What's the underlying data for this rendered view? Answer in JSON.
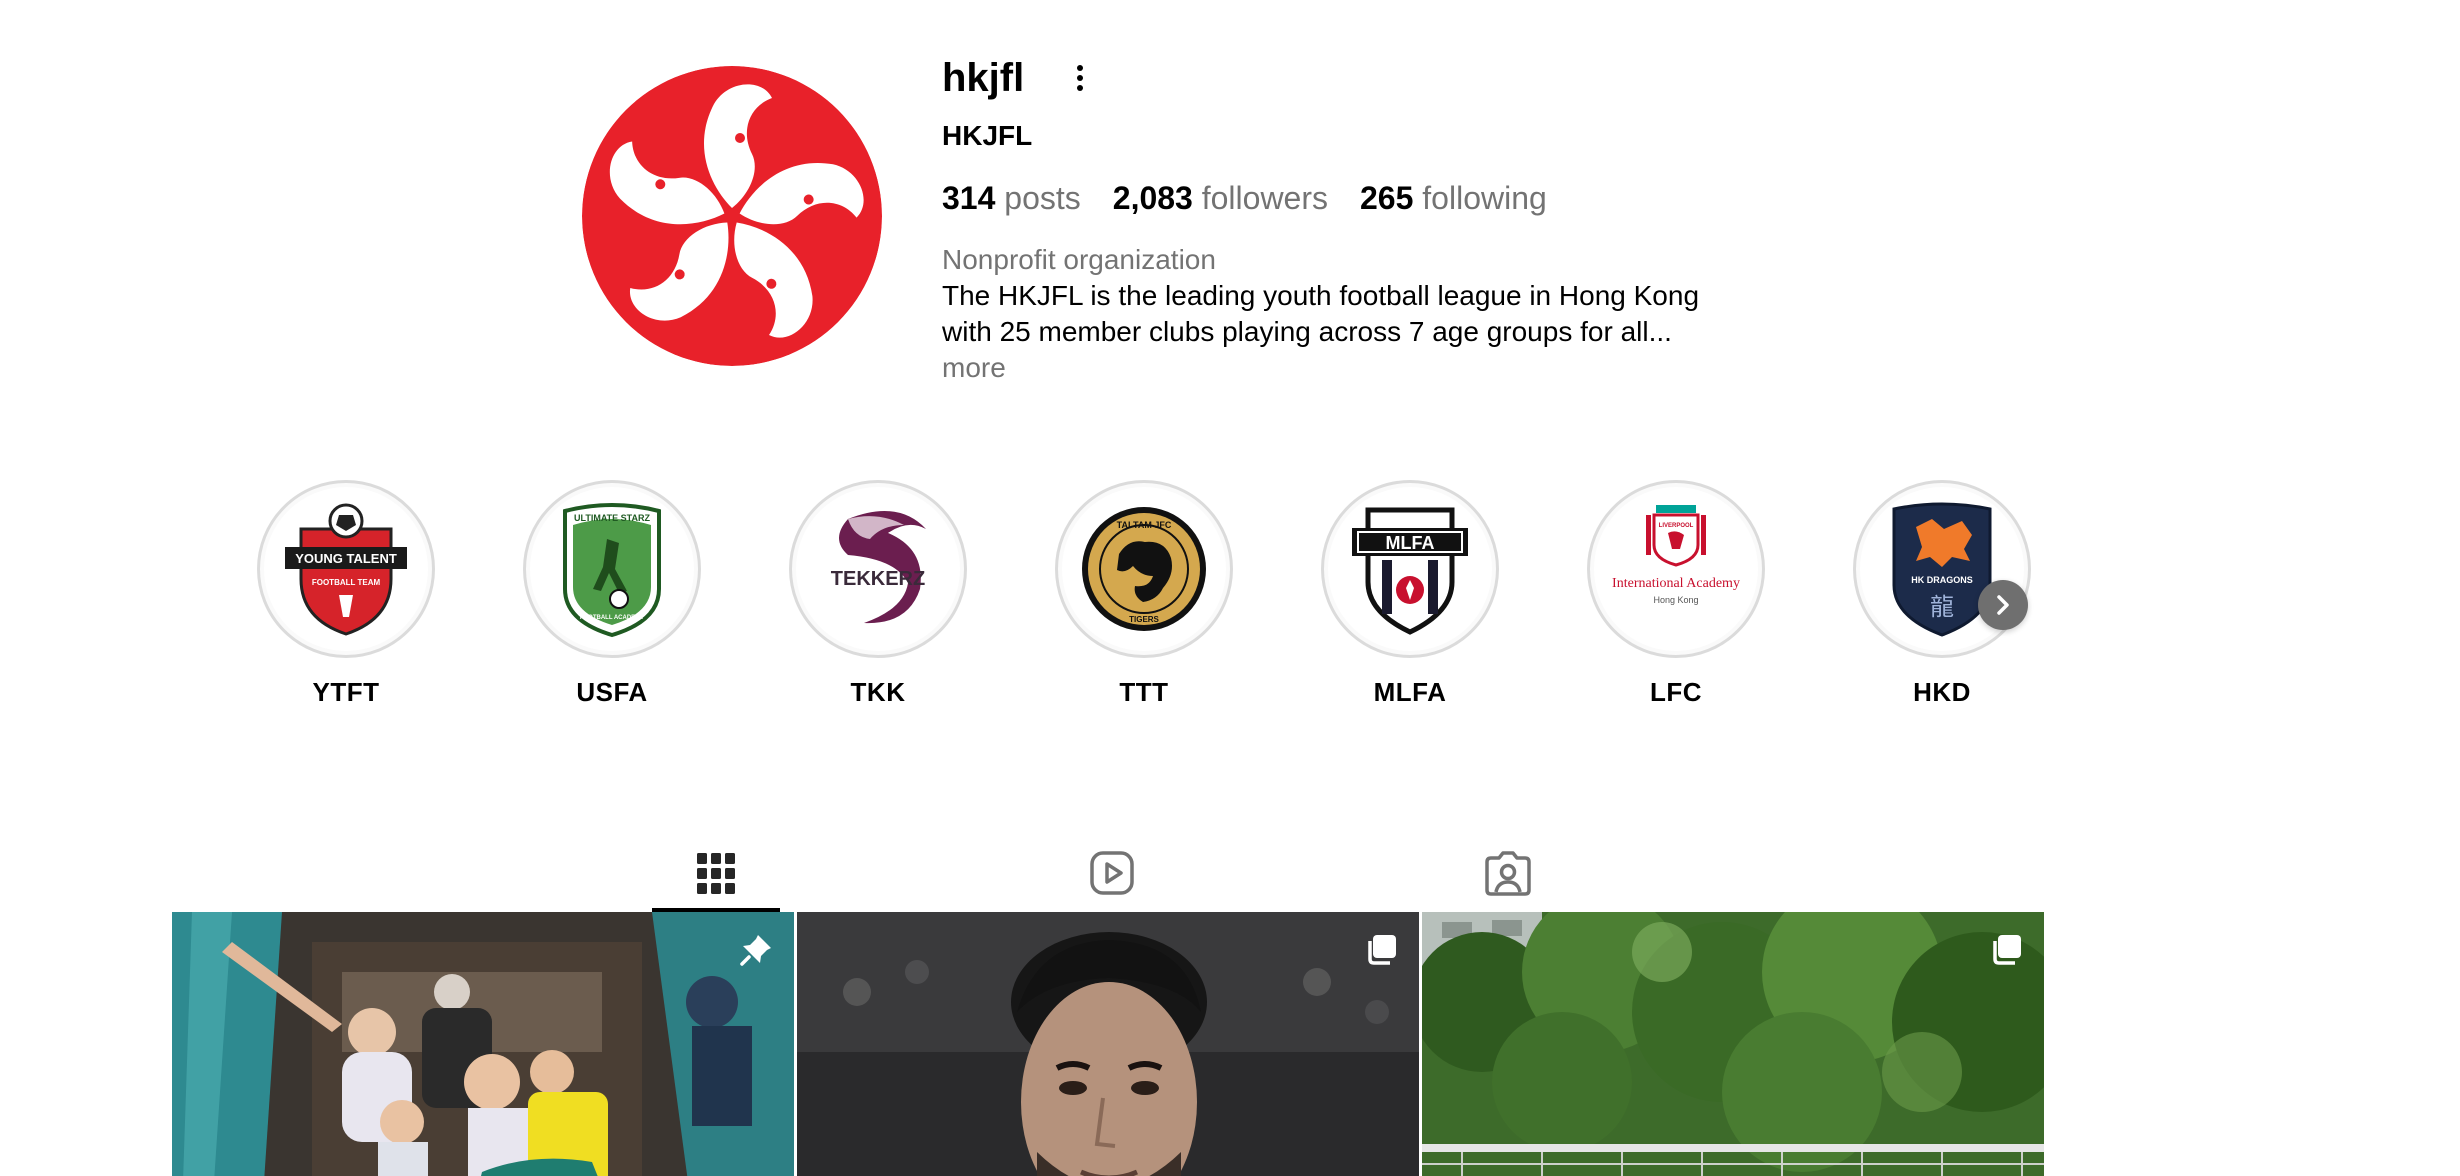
{
  "profile": {
    "username": "hkjfl",
    "full_name": "HKJFL",
    "posts_count": "314",
    "posts_label": "posts",
    "followers_count": "2,083",
    "followers_label": "followers",
    "following_count": "265",
    "following_label": "following",
    "category": "Nonprofit organization",
    "bio": "The HKJFL is the leading youth football league in Hong Kong with 25 member clubs playing across 7 age groups for all...",
    "bio_more": "more",
    "avatar_color": "#e8212a"
  },
  "highlights": [
    {
      "label": "YTFT",
      "logo_text": "YOUNG TALENT",
      "logo_subtext": "FOOTBALL TEAM",
      "color": "#d6232a"
    },
    {
      "label": "USFA",
      "logo_text": "ULTIMATE STARZ",
      "logo_subtext": "FOOTBALL ACADEMY",
      "color": "#3d8a3a"
    },
    {
      "label": "TKK",
      "logo_text": "TEKKERZ",
      "color": "#6b1e4f"
    },
    {
      "label": "TTT",
      "logo_text": "TAI TAM JFC",
      "logo_subtext": "TIGERS",
      "color": "#c99a3a"
    },
    {
      "label": "MLFA",
      "logo_text": "MLFA",
      "color": "#1a1a2e"
    },
    {
      "label": "LFC",
      "logo_text": "LIVERPOOL",
      "logo_subtext": "International Academy",
      "logo_subtext2": "Hong Kong",
      "color": "#c8102e"
    },
    {
      "label": "HKD",
      "logo_text": "HK DRAGONS",
      "logo_subtext": "龍",
      "color": "#1c2b4a"
    }
  ],
  "tabs": [
    {
      "name": "posts",
      "icon": "grid-icon",
      "active": true
    },
    {
      "name": "reels",
      "icon": "reels-icon",
      "active": false
    },
    {
      "name": "tagged",
      "icon": "tagged-icon",
      "active": false
    }
  ],
  "posts": [
    {
      "badge": "pin-icon"
    },
    {
      "badge": "carousel-icon"
    },
    {
      "badge": "carousel-icon"
    }
  ]
}
